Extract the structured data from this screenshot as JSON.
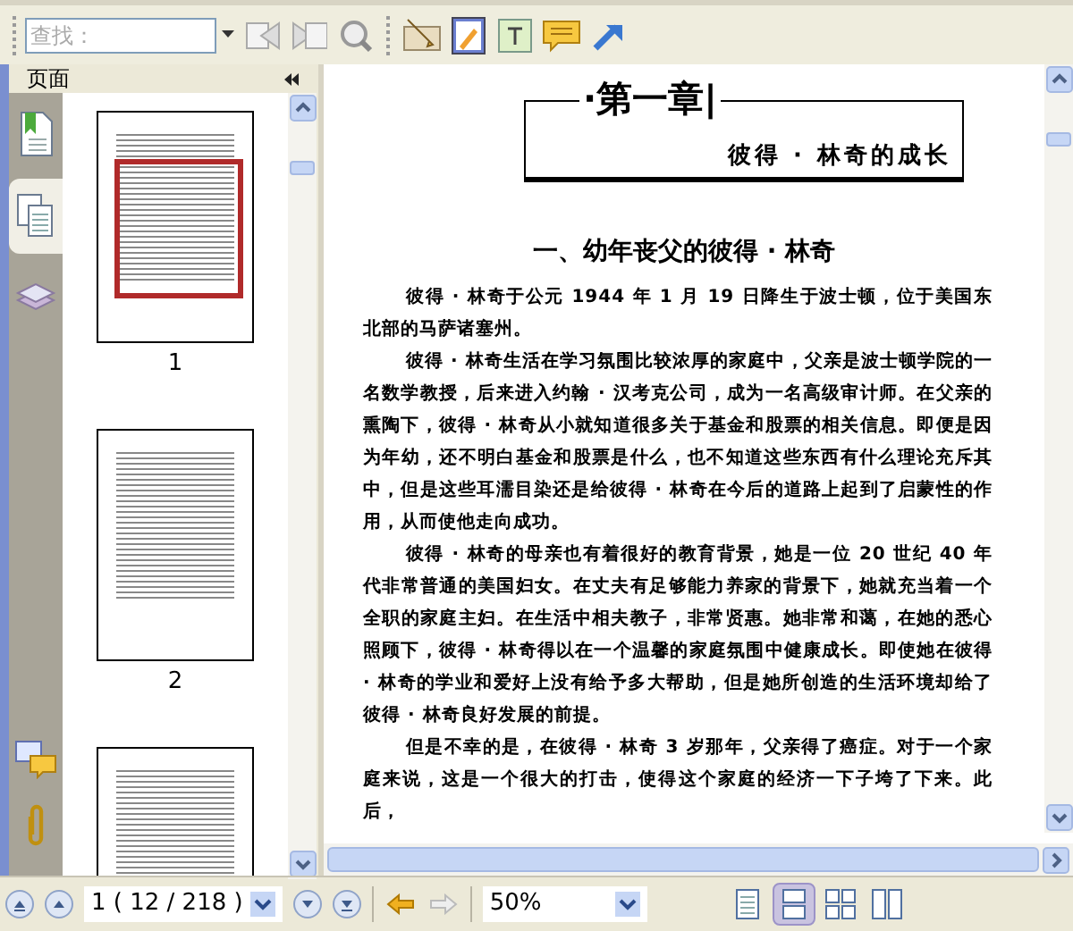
{
  "toolbar": {
    "search": {
      "placeholder": "查找："
    }
  },
  "sidebar": {
    "title": "页面",
    "tabs": [
      {
        "kind": "bookmarks",
        "selected": false
      },
      {
        "kind": "pages",
        "selected": true
      },
      {
        "kind": "layers",
        "selected": false
      }
    ],
    "thumbnails": [
      {
        "label": "1",
        "selected": true
      },
      {
        "label": "2",
        "selected": false
      },
      {
        "selected": false
      }
    ]
  },
  "document": {
    "chapter": "·第一章|",
    "chapter_subtitle": "彼得 · 林奇的成长",
    "section_title": "一、幼年丧父的彼得 · 林奇",
    "paragraphs": [
      "彼得 · 林奇于公元 1944 年 1 月 19 日降生于波士顿，位于美国东北部的马萨诸塞州。",
      "彼得 · 林奇生活在学习氛围比较浓厚的家庭中，父亲是波士顿学院的一名数学教授，后来进入约翰 · 汉考克公司，成为一名高级审计师。在父亲的熏陶下，彼得 · 林奇从小就知道很多关于基金和股票的相关信息。即便是因为年幼，还不明白基金和股票是什么，也不知道这些东西有什么理论充斥其中，但是这些耳濡目染还是给彼得 · 林奇在今后的道路上起到了启蒙性的作用，从而使他走向成功。",
      "彼得 · 林奇的母亲也有着很好的教育背景，她是一位 20 世纪 40 年代非常普通的美国妇女。在丈夫有足够能力养家的背景下，她就充当着一个全职的家庭主妇。在生活中相夫教子，非常贤惠。她非常和蔼，在她的悉心照顾下，彼得 · 林奇得以在一个温馨的家庭氛围中健康成长。即使她在彼得 · 林奇的学业和爱好上没有给予多大帮助，但是她所创造的生活环境却给了彼得 · 林奇良好发展的前提。",
      "但是不幸的是，在彼得 · 林奇 3 岁那年，父亲得了癌症。对于一个家庭来说，这是一个很大的打击，使得这个家庭的经济一下子垮了下来。此后，"
    ]
  },
  "status_bar": {
    "page_field": "1 ( 12 / 218 )",
    "zoom": "50%",
    "back_enabled": true,
    "forward_enabled": false,
    "view_modes": [
      {
        "kind": "single",
        "selected": false
      },
      {
        "kind": "continuous",
        "selected": true
      },
      {
        "kind": "facing",
        "selected": false
      },
      {
        "kind": "continuous_facing",
        "selected": false
      }
    ]
  }
}
